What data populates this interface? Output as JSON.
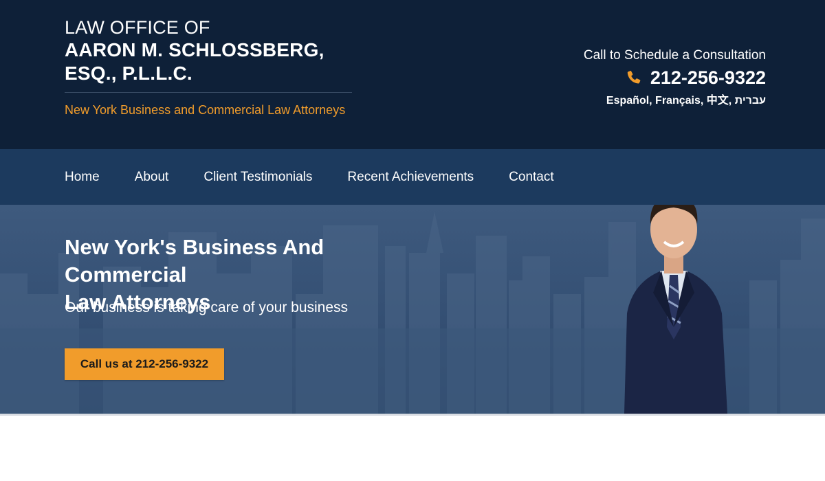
{
  "header": {
    "brand_line1": "LAW OFFICE OF",
    "brand_line2": "AARON M. SCHLOSSBERG,",
    "brand_line3": "ESQ., P.L.L.C.",
    "tagline": "New York Business and Commercial Law Attorneys",
    "contact_cta": "Call to Schedule a Consultation",
    "phone": "212-256-9322",
    "phone_icon": "phone-icon",
    "languages": "Español, Français, 中文, עברית"
  },
  "nav": {
    "items": [
      {
        "label": "Home"
      },
      {
        "label": "About"
      },
      {
        "label": "Client Testimonials"
      },
      {
        "label": "Recent Achievements"
      },
      {
        "label": "Contact"
      }
    ]
  },
  "hero": {
    "title_line1": "New York's Business And Commercial",
    "title_line2": "Law Attorneys",
    "subtitle": "Our business is taking care of your business",
    "cta_label": "Call us at 212-256-9322"
  },
  "colors": {
    "header_bg": "#0e2038",
    "nav_bg": "#1c3a5e",
    "accent": "#f19c2b",
    "hero_bg": "#334e72"
  }
}
